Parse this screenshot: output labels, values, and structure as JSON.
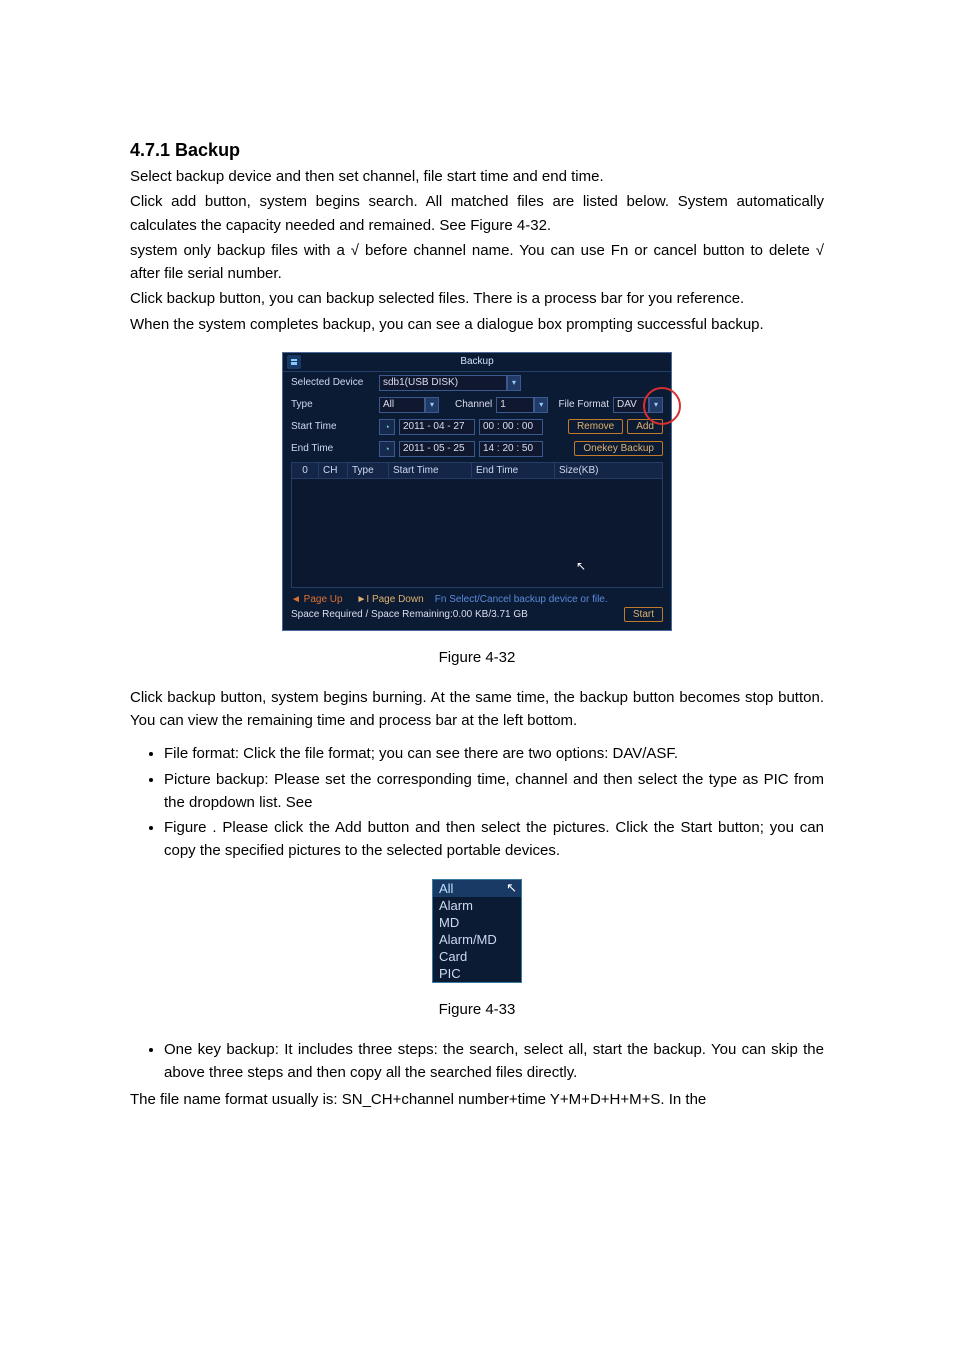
{
  "heading": "4.7.1  Backup",
  "para1": "Select backup device and then set channel, file start time and end time.",
  "para2": "Click add button, system begins search. All matched files are listed below. System automatically calculates the capacity needed and remained. See Figure 4-32.",
  "para3": "system only backup files with a    √  before channel name. You can use Fn or cancel button to delete √ after file serial number.",
  "para4": "Click backup button, you can backup selected files. There is a process bar for you reference.",
  "para5": "When the system completes backup, you can see a dialogue box prompting successful backup.",
  "fig32_caption": "Figure 4-32",
  "para6": "Click backup button, system begins burning. At the same time, the backup button becomes stop button. You can view the remaining time and process bar at the left bottom.",
  "bullet1": "File format: Click the file format; you can see there are two options: DAV/ASF.",
  "bullet2": "Picture backup: Please set the corresponding time, channel and then select the type as PIC from the dropdown list. See",
  "bullet3": "Figure      . Please click the Add button and then select the pictures. Click the Start button; you can copy the specified pictures to the selected portable devices.",
  "fig33_caption": "Figure 4-33",
  "bullet4": "One key backup: It includes three steps: the search, select all, start the backup. You can skip the above three steps and then copy all the searched files directly.",
  "para7": "The file name format usually is: SN_CH+channel number+time Y+M+D+H+M+S. In the",
  "dialog": {
    "title": "Backup",
    "selected_device_label": "Selected Device",
    "selected_device_value": "sdb1(USB DISK)",
    "type_label": "Type",
    "type_value": "All",
    "channel_label": "Channel",
    "channel_value": "1",
    "file_format_label": "File Format",
    "file_format_value": "DAV",
    "start_time_label": "Start Time",
    "start_date": "2011  - 04 - 27",
    "start_time": "00 : 00 : 00",
    "remove_btn": "Remove",
    "add_btn": "Add",
    "end_time_label": "End Time",
    "end_date": "2011  - 05 - 25",
    "end_time": "14 : 20 : 50",
    "onekey_btn": "Onekey Backup",
    "col0": "0",
    "col_ch": "CH",
    "col_type": "Type",
    "col_start": "Start Time",
    "col_end": "End Time",
    "col_size": "Size(KB)",
    "page_up": "◄ Page Up",
    "page_down": "►I Page Down",
    "fn_hint": "Fn Select/Cancel backup device or file.",
    "space_line": "Space Required / Space Remaining:0.00 KB/3.71 GB",
    "start_btn": "Start"
  },
  "dropdown": {
    "opt1": "All",
    "opt2": "Alarm",
    "opt3": "MD",
    "opt4": "Alarm/MD",
    "opt5": "Card",
    "opt6": "PIC"
  }
}
